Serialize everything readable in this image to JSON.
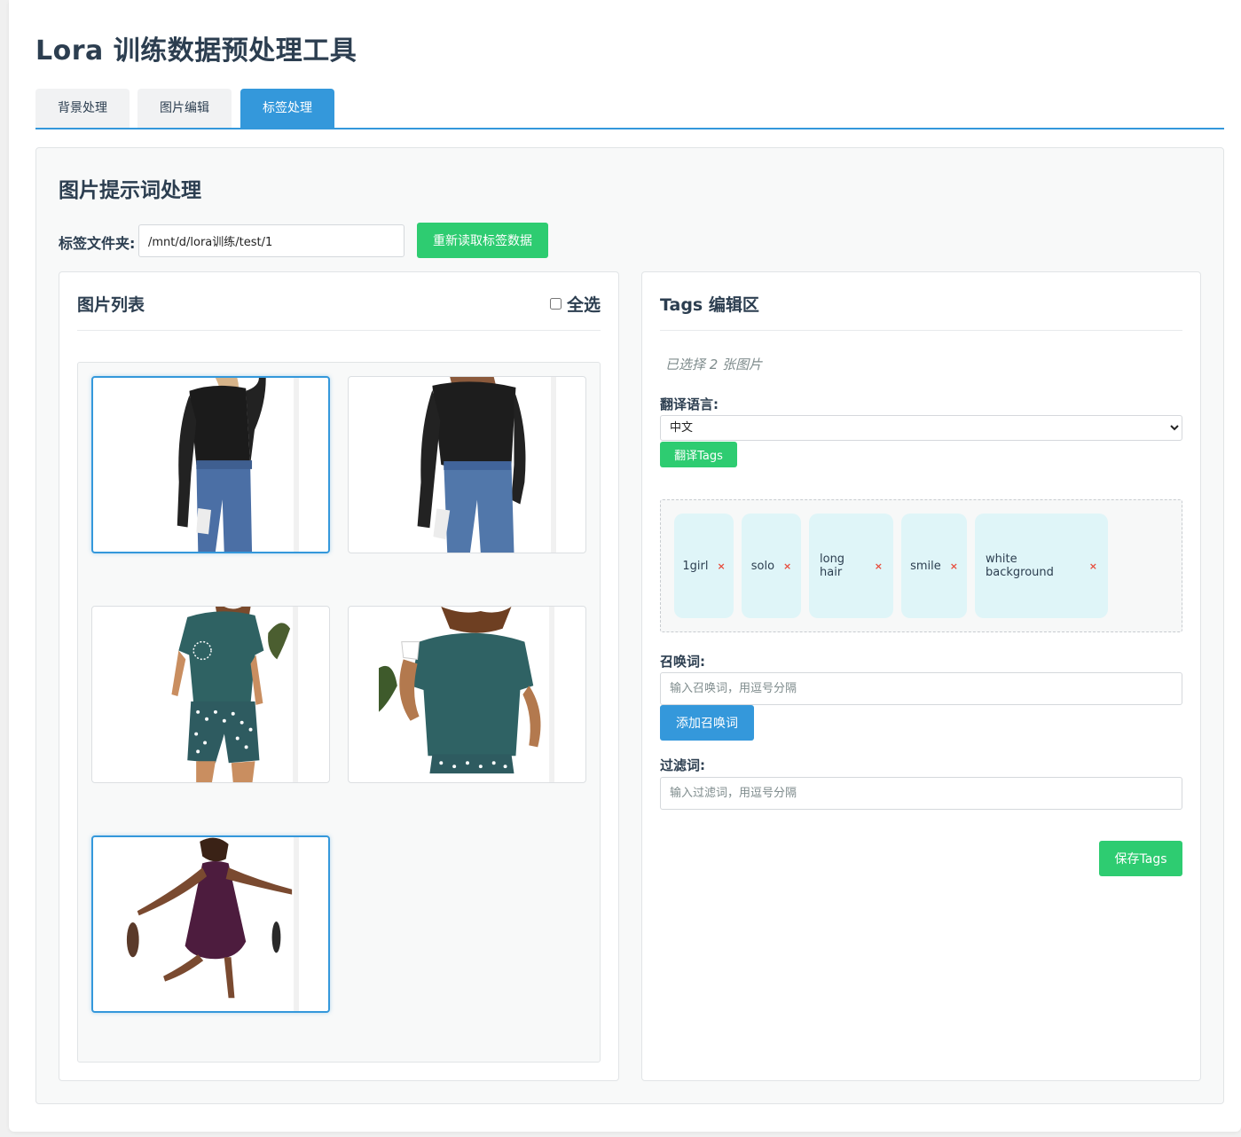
{
  "app": {
    "title": "Lora 训练数据预处理工具"
  },
  "tabs": [
    {
      "label": "背景处理",
      "active": false
    },
    {
      "label": "图片编辑",
      "active": false
    },
    {
      "label": "标签处理",
      "active": true
    }
  ],
  "panel": {
    "title": "图片提示词处理",
    "folder_label": "标签文件夹:",
    "folder_value": "/mnt/d/lora训练/test/1",
    "reload_label": "重新读取标签数据"
  },
  "image_list": {
    "title": "图片列表",
    "select_all_label": "全选",
    "images": [
      {
        "alt": "woman in black mesh top and jeans",
        "selected": true
      },
      {
        "alt": "woman in black mesh top and jeans",
        "selected": false
      },
      {
        "alt": "woman in teal t-shirt and polka-dot shorts",
        "selected": false
      },
      {
        "alt": "woman in teal t-shirt holding cup",
        "selected": false
      },
      {
        "alt": "woman in purple dress jumping",
        "selected": true
      }
    ]
  },
  "tags_editor": {
    "title": "Tags 编辑区",
    "selected_count": "已选择 2 张图片",
    "language_label": "翻译语言:",
    "language_selected": "中文",
    "translate_label": "翻译Tags",
    "tags": [
      "1girl",
      "solo",
      "long hair",
      "smile",
      "white background"
    ],
    "remove_icon": "×",
    "trigger_label": "召唤词:",
    "trigger_placeholder": "输入召唤词，用逗号分隔",
    "add_trigger_label": "添加召唤词",
    "filter_label": "过滤词:",
    "filter_placeholder": "输入过滤词，用逗号分隔",
    "save_label": "保存Tags"
  },
  "colors": {
    "accent": "#3498db",
    "success": "#2ecc71",
    "tag_bg": "#dff5f8",
    "remove": "#e74c3c"
  }
}
